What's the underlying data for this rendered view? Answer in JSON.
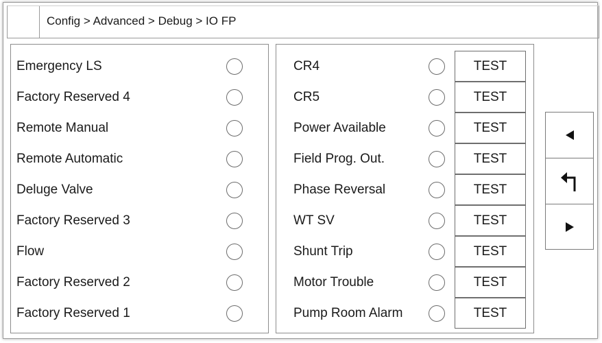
{
  "breadcrumb": "Config > Advanced > Debug > IO FP",
  "inputs": [
    {
      "label": "Emergency LS"
    },
    {
      "label": "Factory Reserved 4"
    },
    {
      "label": "Remote Manual"
    },
    {
      "label": "Remote Automatic"
    },
    {
      "label": "Deluge Valve"
    },
    {
      "label": "Factory Reserved 3"
    },
    {
      "label": "Flow"
    },
    {
      "label": "Factory Reserved 2"
    },
    {
      "label": "Factory Reserved 1"
    }
  ],
  "outputs": [
    {
      "label": "CR4",
      "button": "TEST"
    },
    {
      "label": "CR5",
      "button": "TEST"
    },
    {
      "label": "Power Available",
      "button": "TEST"
    },
    {
      "label": "Field Prog. Out.",
      "button": "TEST"
    },
    {
      "label": "Phase Reversal",
      "button": "TEST"
    },
    {
      "label": "WT SV",
      "button": "TEST"
    },
    {
      "label": "Shunt Trip",
      "button": "TEST"
    },
    {
      "label": "Motor Trouble",
      "button": "TEST"
    },
    {
      "label": "Pump Room Alarm",
      "button": "TEST"
    }
  ],
  "nav": {
    "prev_icon": "left-triangle-icon",
    "back_icon": "return-arrow-icon",
    "next_icon": "right-triangle-icon"
  },
  "colors": {
    "border": "#8c8c8c",
    "indicator_off": "#ffffff"
  }
}
